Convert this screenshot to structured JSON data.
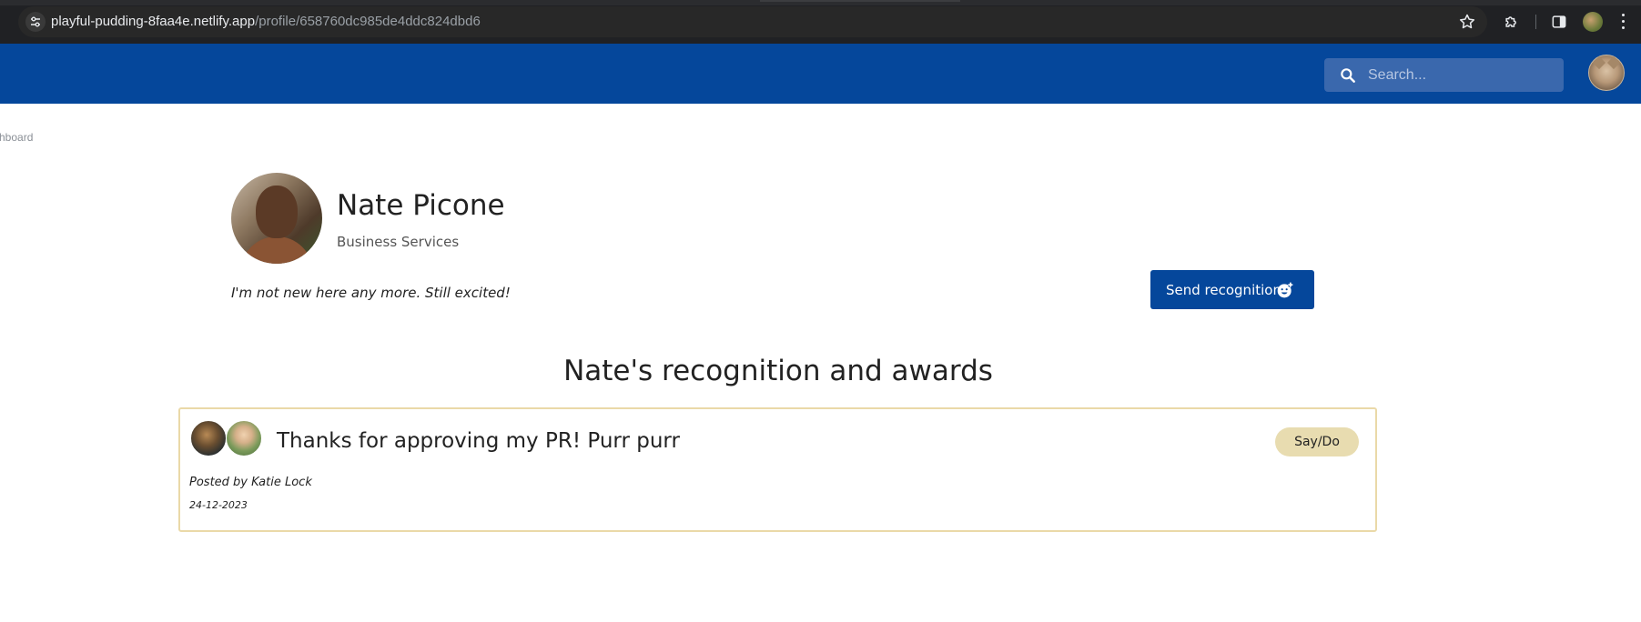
{
  "browser": {
    "url_host": "playful-pudding-8faa4e.netlify.app",
    "url_path": "/profile/658760dc985de4ddc824dbd6"
  },
  "header": {
    "search_placeholder": "Search..."
  },
  "breadcrumb": "shboard",
  "profile": {
    "name": "Nate Picone",
    "department": "Business Services",
    "bio": "I'm not new here any more. Still excited!",
    "send_button_label": "Send recognition"
  },
  "recognitions": {
    "section_title": "Nate's recognition and awards",
    "items": [
      {
        "message": "Thanks for approving my PR! Purr purr",
        "badge": "Say/Do",
        "posted_by": "Posted by Katie Lock",
        "date": "24-12-2023"
      }
    ]
  },
  "colors": {
    "brand_blue": "#05479b",
    "card_border": "#ead9a8",
    "badge_bg": "#e8dcb0"
  },
  "icons": {
    "site_info": "tune-icon",
    "bookmark": "star-icon",
    "extensions": "puzzle-icon",
    "side_panel": "side-panel-icon",
    "menu": "more-vert-icon",
    "search": "search-icon",
    "send": "add-reaction-icon"
  }
}
